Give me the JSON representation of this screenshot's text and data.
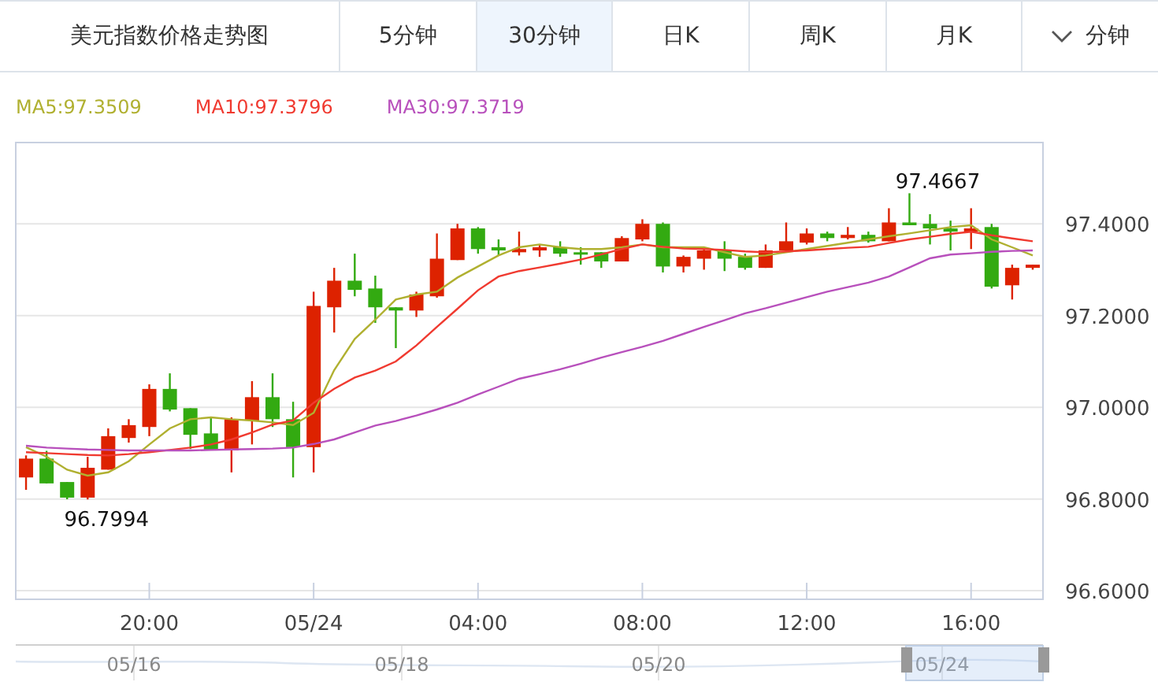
{
  "title": "美元指数价格走势图",
  "tabs": [
    {
      "label": "5分钟",
      "selected": false,
      "kind": "tab"
    },
    {
      "label": "30分钟",
      "selected": true,
      "kind": "tab"
    },
    {
      "label": "日K",
      "selected": false,
      "kind": "tab"
    },
    {
      "label": "周K",
      "selected": false,
      "kind": "tab"
    },
    {
      "label": "月K",
      "selected": false,
      "kind": "tab"
    },
    {
      "label": "分钟",
      "selected": false,
      "kind": "dropdown"
    }
  ],
  "legend": [
    {
      "value": ":97.3509"
    },
    {
      "value": ":97.3796"
    },
    {
      "value": ":97.3719"
    }
  ],
  "chart": {
    "chart_data": {
      "type": "candlestick",
      "grid": true,
      "ylim": [
        96.583,
        97.579
      ],
      "categories": [
        null,
        null,
        null,
        null,
        null,
        null,
        "20:00",
        null,
        null,
        null,
        null,
        null,
        null,
        null,
        "05/24",
        null,
        null,
        null,
        null,
        null,
        null,
        null,
        "04:00",
        null,
        null,
        null,
        null,
        null,
        null,
        null,
        "08:00",
        null,
        null,
        null,
        null,
        null,
        null,
        null,
        "12:00",
        null,
        null,
        null,
        null,
        null,
        null,
        null,
        "16:00",
        null,
        null,
        null
      ],
      "yticks": [
        {
          "value": 97.4,
          "label": "97.4000"
        },
        {
          "value": 97.2,
          "label": "97.2000"
        },
        {
          "value": 97.0,
          "label": "97.0000"
        },
        {
          "value": 96.8,
          "label": "96.8000"
        },
        {
          "value": 96.6,
          "label": "96.6000"
        }
      ],
      "ohlc": [
        [
          96.847,
          96.895,
          96.82,
          96.888
        ],
        [
          96.888,
          96.905,
          96.834,
          96.834
        ],
        [
          96.837,
          96.837,
          96.7994,
          96.803
        ],
        [
          96.803,
          96.892,
          96.799,
          96.868
        ],
        [
          96.864,
          96.954,
          96.864,
          96.937
        ],
        [
          96.933,
          96.974,
          96.923,
          96.961
        ],
        [
          96.957,
          97.05,
          96.937,
          97.04
        ],
        [
          97.04,
          97.074,
          96.991,
          96.995
        ],
        [
          96.998,
          96.998,
          96.909,
          96.94
        ],
        [
          96.943,
          96.978,
          96.906,
          96.906
        ],
        [
          96.906,
          96.978,
          96.858,
          96.974
        ],
        [
          96.971,
          97.057,
          96.919,
          97.022
        ],
        [
          97.022,
          97.074,
          96.957,
          96.974
        ],
        [
          96.974,
          97.012,
          96.847,
          96.913
        ],
        [
          96.913,
          97.252,
          96.858,
          97.221
        ],
        [
          97.218,
          97.304,
          97.163,
          97.276
        ],
        [
          97.276,
          97.335,
          97.242,
          97.256
        ],
        [
          97.259,
          97.287,
          97.184,
          97.218
        ],
        [
          97.218,
          97.218,
          97.129,
          97.211
        ],
        [
          97.211,
          97.252,
          97.197,
          97.246
        ],
        [
          97.242,
          97.379,
          97.239,
          97.324
        ],
        [
          97.321,
          97.4,
          97.321,
          97.39
        ],
        [
          97.39,
          97.393,
          97.335,
          97.345
        ],
        [
          97.349,
          97.366,
          97.331,
          97.342
        ],
        [
          97.338,
          97.383,
          97.331,
          97.345
        ],
        [
          97.342,
          97.355,
          97.328,
          97.349
        ],
        [
          97.349,
          97.362,
          97.328,
          97.335
        ],
        [
          97.338,
          97.349,
          97.311,
          97.335
        ],
        [
          97.338,
          97.338,
          97.304,
          97.318
        ],
        [
          97.318,
          97.373,
          97.318,
          97.369
        ],
        [
          97.366,
          97.41,
          97.362,
          97.4
        ],
        [
          97.4,
          97.403,
          97.294,
          97.307
        ],
        [
          97.307,
          97.331,
          97.294,
          97.328
        ],
        [
          97.324,
          97.345,
          97.3,
          97.342
        ],
        [
          97.342,
          97.362,
          97.297,
          97.324
        ],
        [
          97.328,
          97.335,
          97.3,
          97.304
        ],
        [
          97.304,
          97.355,
          97.304,
          97.342
        ],
        [
          97.342,
          97.403,
          97.342,
          97.362
        ],
        [
          97.359,
          97.39,
          97.355,
          97.379
        ],
        [
          97.379,
          97.383,
          97.362,
          97.369
        ],
        [
          97.369,
          97.393,
          97.366,
          97.376
        ],
        [
          97.376,
          97.383,
          97.359,
          97.362
        ],
        [
          97.362,
          97.434,
          97.362,
          97.403
        ],
        [
          97.403,
          97.4667,
          97.397,
          97.397
        ],
        [
          97.4,
          97.421,
          97.355,
          97.39
        ],
        [
          97.39,
          97.407,
          97.342,
          97.383
        ],
        [
          97.383,
          97.434,
          97.345,
          97.39
        ],
        [
          97.393,
          97.4,
          97.259,
          97.263
        ],
        [
          97.266,
          97.311,
          97.235,
          97.304
        ],
        [
          97.304,
          97.311,
          97.3,
          97.311
        ]
      ],
      "series": [
        {
          "name": "MA5",
          "type": "line",
          "color": "#b0b030",
          "values": [
            96.913,
            96.892,
            96.864,
            96.851,
            96.858,
            96.882,
            96.919,
            96.954,
            96.974,
            96.978,
            96.974,
            96.971,
            96.967,
            96.961,
            96.988,
            97.081,
            97.149,
            97.191,
            97.235,
            97.246,
            97.252,
            97.283,
            97.307,
            97.331,
            97.349,
            97.355,
            97.349,
            97.345,
            97.345,
            97.349,
            97.355,
            97.349,
            97.349,
            97.349,
            97.338,
            97.328,
            97.331,
            97.338,
            97.345,
            97.352,
            97.359,
            97.366,
            97.373,
            97.379,
            97.386,
            97.393,
            97.397,
            97.366,
            97.349,
            97.331
          ]
        },
        {
          "name": "MA10",
          "type": "line",
          "color": "#f03a30",
          "values": [
            96.902,
            96.9,
            96.898,
            96.896,
            96.895,
            96.898,
            96.902,
            96.907,
            96.912,
            96.919,
            96.93,
            96.945,
            96.962,
            96.971,
            97.01,
            97.04,
            97.065,
            97.08,
            97.1,
            97.135,
            97.175,
            97.215,
            97.255,
            97.285,
            97.297,
            97.305,
            97.313,
            97.322,
            97.333,
            97.345,
            97.355,
            97.35,
            97.346,
            97.345,
            97.343,
            97.34,
            97.338,
            97.34,
            97.342,
            97.345,
            97.348,
            97.35,
            97.358,
            97.366,
            97.372,
            97.378,
            97.383,
            97.375,
            97.368,
            97.362
          ]
        },
        {
          "name": "MA30",
          "type": "line",
          "color": "#b850bc",
          "values": [
            96.916,
            96.912,
            96.91,
            96.908,
            96.907,
            96.906,
            96.906,
            96.906,
            96.906,
            96.907,
            96.908,
            96.909,
            96.91,
            96.912,
            96.92,
            96.93,
            96.945,
            96.96,
            96.97,
            96.982,
            96.995,
            97.01,
            97.028,
            97.045,
            97.062,
            97.072,
            97.083,
            97.095,
            97.108,
            97.12,
            97.132,
            97.145,
            97.16,
            97.175,
            97.19,
            97.205,
            97.216,
            97.228,
            97.24,
            97.252,
            97.262,
            97.272,
            97.285,
            97.305,
            97.325,
            97.333,
            97.336,
            97.339,
            97.341,
            97.342
          ]
        }
      ],
      "annotations": [
        "97.4667",
        "96.7994"
      ]
    }
  },
  "navigator": {
    "labels": [
      "05/16",
      "05/18",
      "05/20",
      "05/24"
    ]
  }
}
